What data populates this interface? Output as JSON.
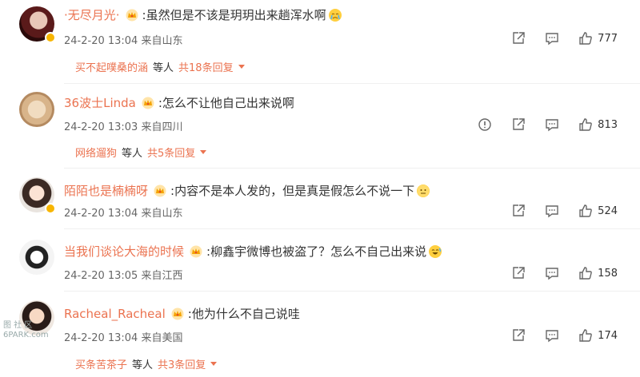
{
  "comments": [
    {
      "username": "·无尽月光·",
      "text": ":虽然但是不该是玥玥出来趟浑水啊",
      "meta": "24-2-20 13:04 来自山东",
      "likes": "777",
      "reply_user": "买不起噗桑的涵",
      "reply_etc": "等人",
      "reply_total": "共18条回复"
    },
    {
      "username": "36波士Linda",
      "text": ":怎么不让他自己出来说啊",
      "meta": "24-2-20 13:03 来自四川",
      "likes": "813",
      "reply_user": "网络遛狗",
      "reply_etc": "等人",
      "reply_total": "共5条回复"
    },
    {
      "username": "陌陌也是楠楠呀",
      "text": ":内容不是本人发的，但是真是假怎么不说一下",
      "meta": "24-2-20 13:04 来自山东",
      "likes": "524"
    },
    {
      "username": "当我们谈论大海的时候",
      "text": ":柳鑫宇微博也被盗了？怎么不自己出来说",
      "meta": "24-2-20 13:05 来自江西",
      "likes": "158"
    },
    {
      "username": "Racheal_Racheal",
      "text": ":他为什么不自己说哇",
      "meta": "24-2-20 13:04 来自美国",
      "likes": "174",
      "reply_user": "买条苦茶子",
      "reply_etc": "等人",
      "reply_total": "共3条回复"
    }
  ],
  "icons": {
    "share": "share-icon",
    "comment": "comment-icon",
    "like": "thumbs-up-icon",
    "report": "report-icon",
    "crown": "fan-crown-badge-icon",
    "emoji": "emoji-icon"
  },
  "colors": {
    "username": "#eb7350",
    "text": "#333333",
    "meta": "#666666",
    "verified_badge": "#f7b500"
  },
  "watermark": {
    "line1": "图 社 区",
    "line2": "6PARK.com"
  }
}
